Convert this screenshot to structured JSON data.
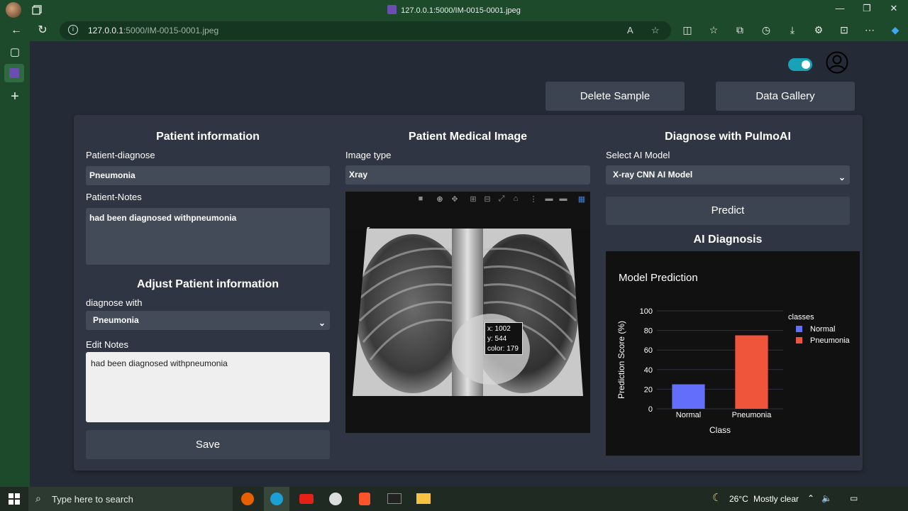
{
  "browser": {
    "tab_title": "127.0.0.1:5000/IM-0015-0001.jpeg",
    "url_host": "127.0.0.1",
    "url_path": ":5000/IM-0015-0001.jpeg"
  },
  "header": {
    "delete_label": "Delete Sample",
    "gallery_label": "Data Gallery"
  },
  "patient": {
    "title": "Patient information",
    "diagnose_label": "Patient-diagnose",
    "diagnose_value": "Pneumonia",
    "notes_label": "Patient-Notes",
    "notes_value": "had been diagnosed withpneumonia",
    "adjust_title": "Adjust Patient information",
    "diagnose_with_label": "diagnose with",
    "diagnose_with_value": "Pneumonia",
    "edit_notes_label": "Edit Notes",
    "edit_notes_value": "had been diagnosed withpneumonia",
    "save_label": "Save"
  },
  "image": {
    "title": "Patient Medical Image",
    "type_label": "Image type",
    "type_value": "Xray",
    "hover_x": "x: 1002",
    "hover_y": "y: 544",
    "hover_color": "color: 179"
  },
  "ai": {
    "title": "Diagnose with PulmoAI",
    "model_label": "Select AI Model",
    "model_value": "X-ray CNN AI Model",
    "predict_label": "Predict",
    "diagnosis_title": "AI Diagnosis"
  },
  "chart_data": {
    "type": "bar",
    "title": "Model Prediction",
    "categories": [
      "Normal",
      "Pneumonia"
    ],
    "values": [
      25,
      75
    ],
    "colors": [
      "#636efa",
      "#ef553b"
    ],
    "xlabel": "Class",
    "ylabel": "Prediction Score (%)",
    "ylim": [
      0,
      100
    ],
    "yticks": [
      0,
      20,
      40,
      60,
      80,
      100
    ],
    "legend_title": "classes",
    "legend": [
      "Normal",
      "Pneumonia"
    ],
    "legend_position": "top-right"
  },
  "taskbar": {
    "search_placeholder": "Type here to search",
    "weather_temp": "26°C",
    "weather_text": "Mostly clear"
  },
  "colors": {
    "accent": "#17a2b8",
    "browser_frame": "#1d4a2b",
    "page_bg": "#252b36"
  }
}
